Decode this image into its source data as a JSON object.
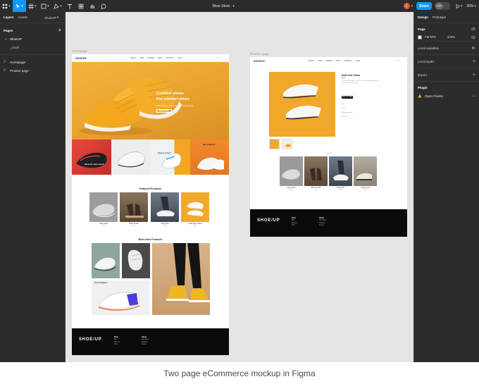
{
  "toolbar": {
    "title": "Shoe Store",
    "avatar_initial": "J",
    "share_label": "Share",
    "dev_mode_label": "</>",
    "zoom": "30%",
    "colors": {
      "bg": "#2c2c2c",
      "accent": "#0d99ff"
    }
  },
  "left_panel": {
    "tabs": [
      "Layers",
      "Assets"
    ],
    "file_name": "ShoeUP",
    "pages_title": "Pages",
    "add_icon": "+",
    "pages": [
      {
        "label": "ShoeUP",
        "selected": true
      },
      {
        "label": "_cover",
        "selected": false
      }
    ],
    "layers": [
      "Homepage",
      "Product page"
    ]
  },
  "right_panel": {
    "tabs": [
      "Design",
      "Prototype"
    ],
    "page_title": "Page",
    "fill_hex": "F5F5F5",
    "fill_opacity": "100%",
    "rows": [
      "Local variables",
      "Local styles",
      "Export"
    ],
    "plugin_title": "Plugin",
    "plugin_name": "Open Pixelot"
  },
  "canvas": {
    "homepage": {
      "label": "Homepage",
      "logo": "SHOEUP",
      "nav_links": [
        "ABOUT",
        "MEN",
        "WOMEN",
        "KIDS",
        "CONTACT",
        "SALE"
      ],
      "nav_icons": "⌕ ♡ ◻",
      "hero_title_1": "Comfort shoes",
      "hero_title_2": "For comfort times",
      "hero_sub": "Lorem ipsum dolor sit amet consectetur",
      "hero_button": "SHOP NOW",
      "tile_captions": [
        "Shoes for every season",
        "Style & comfort",
        "New collection"
      ],
      "featured_title": "Featured Products",
      "featured": [
        {
          "name": "Gray Nova",
          "price": "$120"
        },
        {
          "name": "Brick Sneak",
          "price": "$95"
        },
        {
          "name": "Nova Drift",
          "price": "$110"
        },
        {
          "name": "Swift Sole Yellow",
          "price": "$130"
        }
      ],
      "bestseller_title": "Best seller Products",
      "bestseller_caption": "Fresh Sneakers",
      "footer_logo": "SHOE/UP",
      "footer_cols": [
        {
          "heading": "Shop",
          "items": [
            "Men",
            "Women",
            "Kids",
            "Sale"
          ]
        },
        {
          "heading": "About",
          "items": [
            "Our Story",
            "Careers",
            "Stores",
            "Contact us"
          ]
        }
      ]
    },
    "product_page": {
      "label": "Product page",
      "logo": "SHOEUP",
      "nav_links": [
        "ABOUT",
        "MEN",
        "WOMEN",
        "KIDS",
        "CONTACT",
        "SALE"
      ],
      "nav_icons": "⌕ ♡ ◻",
      "product_title": "Swift Sole Yellow",
      "product_price": "$130",
      "product_desc": "Lorem ipsum dolor sit amet, consectetur adipiscing elit, sed do eiusmod tempor.",
      "add_button": "ADD TO CART",
      "detail_lines": [
        "Size",
        "Color",
        "Shipping details",
        "Returns"
      ],
      "related_title": "Featured",
      "related": [
        {
          "name": "Gray Nova",
          "price": "$120"
        },
        {
          "name": "Brick Sneak",
          "price": "$95"
        },
        {
          "name": "Nova Drift",
          "price": "$110"
        },
        {
          "name": "Street Low",
          "price": "$105"
        }
      ],
      "footer_logo": "SHOE/UP",
      "footer_cols": [
        {
          "heading": "Shop",
          "items": [
            "Men",
            "Women",
            "Kids",
            "Sale"
          ]
        },
        {
          "heading": "About",
          "items": [
            "Our Story",
            "Careers",
            "Stores",
            "Contact us"
          ]
        }
      ]
    }
  },
  "caption": "Two page eCommerce mockup in Figma"
}
